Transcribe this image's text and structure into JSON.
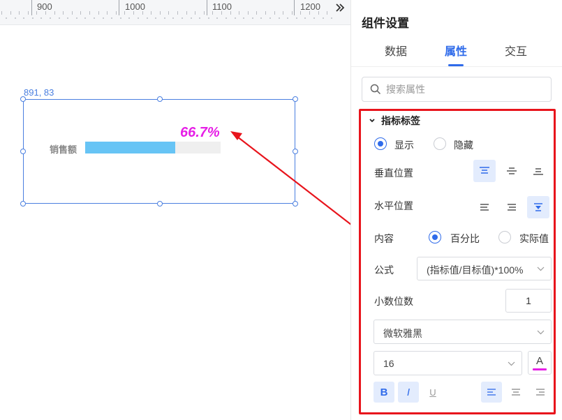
{
  "ruler": {
    "labels": [
      "900",
      "1000",
      "1100",
      "1200"
    ]
  },
  "canvas": {
    "coordinates": "891, 83",
    "widget": {
      "label": "销售额",
      "value_text": "66.7%",
      "progress_fraction": 0.667
    },
    "colors": {
      "bar_fill": "#67c4f5",
      "value_text": "#e61fe6",
      "selection": "#4a7fe0",
      "arrow": "#e8141c"
    }
  },
  "panel": {
    "title": "组件设置",
    "tabs": [
      {
        "label": "数据"
      },
      {
        "label": "属性",
        "active": true
      },
      {
        "label": "交互"
      }
    ],
    "search": {
      "placeholder": "搜索属性"
    },
    "section": {
      "title": "指标标签",
      "visibility": {
        "options": [
          "显示",
          "隐藏"
        ],
        "selected": "显示"
      },
      "vertical_position": {
        "label": "垂直位置",
        "selected": "top"
      },
      "horizontal_position": {
        "label": "水平位置",
        "selected": "right"
      },
      "content": {
        "label": "内容",
        "options": [
          "百分比",
          "实际值"
        ],
        "selected": "百分比"
      },
      "formula": {
        "label": "公式",
        "value": "(指标值/目标值)*100%"
      },
      "decimals": {
        "label": "小数位数",
        "value": "1"
      },
      "font_family": {
        "value": "微软雅黑"
      },
      "font_size": {
        "value": "16"
      },
      "font_color": {
        "glyph": "A",
        "color": "#e61fe6"
      },
      "format": {
        "bold": "B",
        "italic": "I",
        "underline": "U",
        "bold_on": true,
        "italic_on": true,
        "underline_on": false
      },
      "text_align": {
        "selected": "left"
      }
    }
  },
  "accent_color": "#2f6bea"
}
